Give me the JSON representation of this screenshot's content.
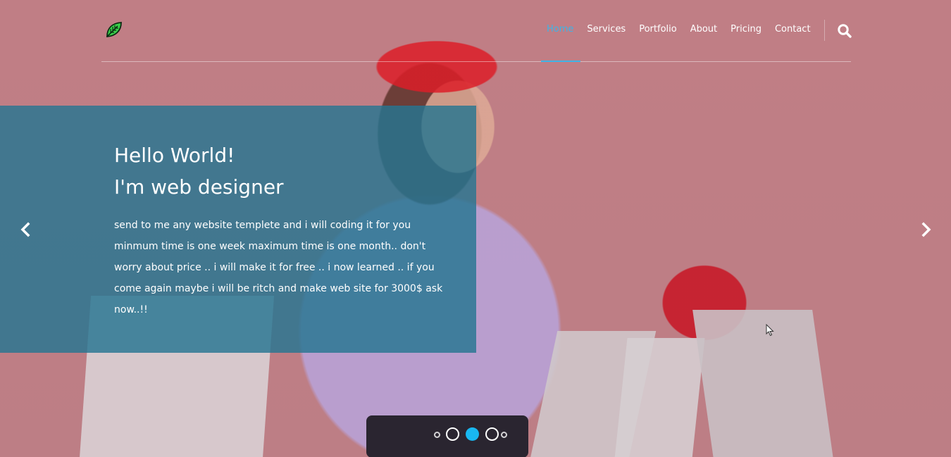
{
  "nav": {
    "items": [
      {
        "label": "Home",
        "active": true
      },
      {
        "label": "Services",
        "active": false
      },
      {
        "label": "Portfolio",
        "active": false
      },
      {
        "label": "About",
        "active": false
      },
      {
        "label": "Pricing",
        "active": false
      },
      {
        "label": "Contact",
        "active": false
      }
    ],
    "search_icon": "search-icon",
    "logo_icon": "leaf-icon"
  },
  "slide": {
    "title_line1": "Hello World!",
    "title_line2": "I'm web designer",
    "text": "send to me any website templete and i will coding it for you minmum time is one week maximum time is one month.. don't worry about price .. i will make it for free .. i now learned .. if you come again maybe i will be ritch and make web site for 3000$ ask now..!!"
  },
  "carousel": {
    "prev_icon": "chevron-left-icon",
    "next_icon": "chevron-right-icon",
    "indicator_count": 3,
    "active_indicator": 2
  },
  "colors": {
    "accent": "#3fb3e6",
    "caption_bg": "#267591",
    "indicator_active": "#19b7f0",
    "background": "#c07e85"
  }
}
